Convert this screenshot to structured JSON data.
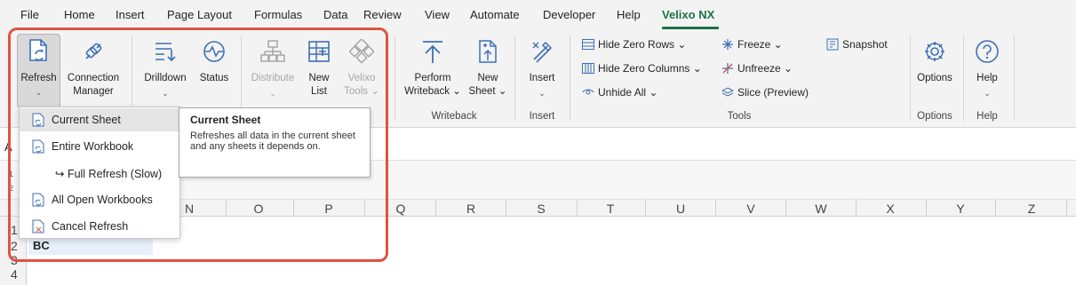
{
  "menu_tabs": [
    "File",
    "Home",
    "Insert",
    "Page Layout",
    "Formulas",
    "Data",
    "Review",
    "View",
    "Automate",
    "Developer",
    "Help",
    "Velixo NX"
  ],
  "ribbon": {
    "refresh": {
      "line1": "Refresh",
      "dd": "⌄"
    },
    "connection_manager": {
      "line1": "Connection",
      "line2": "Manager"
    },
    "drilldown": {
      "line1": "Drilldown",
      "dd": "⌄"
    },
    "status": {
      "line1": "Status"
    },
    "distribute": {
      "line1": "Distribute",
      "dd": "⌄"
    },
    "new_list": {
      "line1": "New",
      "line2": "List"
    },
    "velixo_tools": {
      "line1": "Velixo",
      "line2": "Tools ⌄"
    },
    "perform_writeback": {
      "line1": "Perform",
      "line2": "Writeback ⌄"
    },
    "new_sheet": {
      "line1": "New",
      "line2": "Sheet ⌄"
    },
    "insert": {
      "line1": "Insert",
      "dd": "⌄"
    },
    "hide_zero_rows": "Hide Zero Rows ⌄",
    "hide_zero_columns": "Hide Zero Columns ⌄",
    "unhide_all": "Unhide All ⌄",
    "freeze": "Freeze ⌄",
    "unfreeze": "Unfreeze ⌄",
    "slice": "Slice (Preview)",
    "snapshot": "Snapshot",
    "options": {
      "line1": "Options"
    },
    "help": {
      "line1": "Help",
      "dd": "⌄"
    },
    "groups": {
      "writeback": "Writeback",
      "insert": "Insert",
      "tools": "Tools",
      "options": "Options",
      "help": "Help"
    }
  },
  "formula_bar": {
    "namebox": "A"
  },
  "outline": {
    "levels": [
      "1",
      "2"
    ]
  },
  "columns": [
    "N",
    "O",
    "P",
    "Q",
    "R",
    "S",
    "T",
    "U",
    "V",
    "W",
    "X",
    "Y",
    "Z"
  ],
  "rows": [
    "1",
    "2",
    "3",
    "4"
  ],
  "cell_bc": "BC",
  "refresh_menu": {
    "items": [
      "Current Sheet",
      "Entire Workbook",
      "↪ Full Refresh (Slow)",
      "All Open Workbooks",
      "Cancel Refresh"
    ]
  },
  "tooltip": {
    "title": "Current Sheet",
    "body": "Refreshes all data in the current sheet and any sheets it depends on."
  },
  "colors": {
    "accent": "#1e7145",
    "highlight": "#e0533f",
    "icon_blue": "#3d6fb6"
  }
}
